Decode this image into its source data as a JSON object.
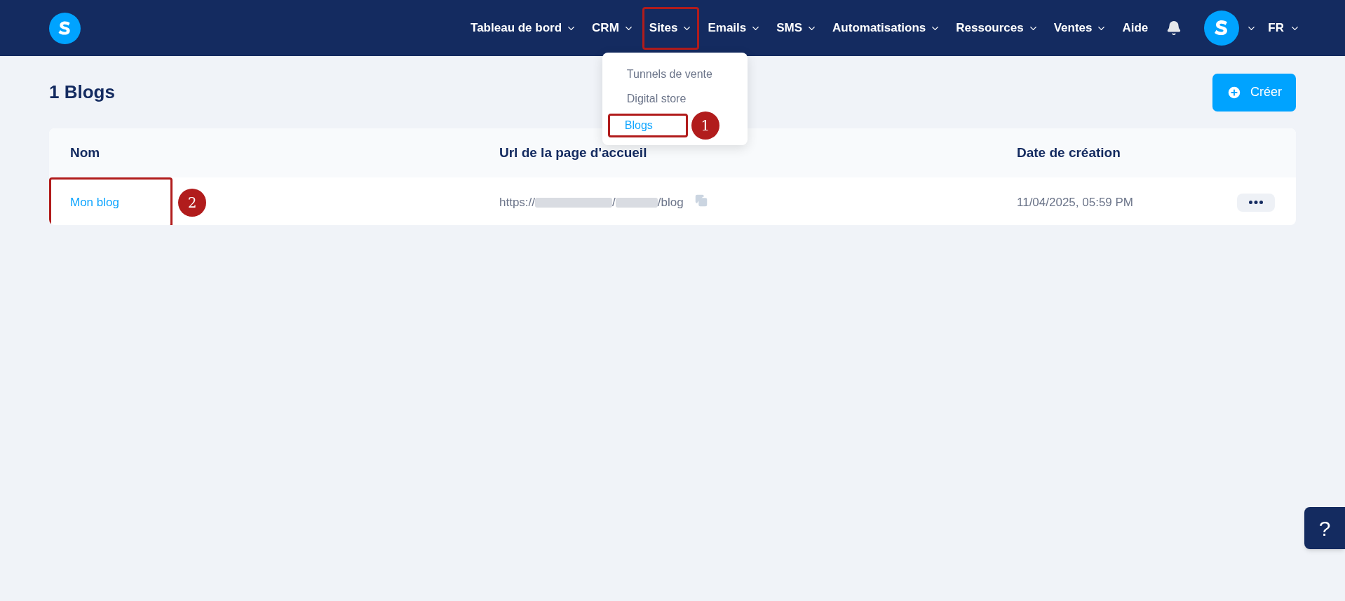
{
  "nav": {
    "items": [
      {
        "label": "Tableau de bord",
        "has_menu": true,
        "highlighted": false
      },
      {
        "label": "CRM",
        "has_menu": true,
        "highlighted": false
      },
      {
        "label": "Sites",
        "has_menu": true,
        "highlighted": true,
        "dropdown": [
          {
            "label": "Tunnels de vente",
            "selected": false,
            "highlighted": false
          },
          {
            "label": "Digital store",
            "selected": false,
            "highlighted": false
          },
          {
            "label": "Blogs",
            "selected": true,
            "highlighted": true,
            "badge": "1"
          }
        ]
      },
      {
        "label": "Emails",
        "has_menu": true,
        "highlighted": false
      },
      {
        "label": "SMS",
        "has_menu": true,
        "highlighted": false
      },
      {
        "label": "Automatisations",
        "has_menu": true,
        "highlighted": false
      },
      {
        "label": "Ressources",
        "has_menu": true,
        "highlighted": false
      },
      {
        "label": "Ventes",
        "has_menu": true,
        "highlighted": false
      },
      {
        "label": "Aide",
        "has_menu": false,
        "highlighted": false
      }
    ],
    "language": "FR"
  },
  "page": {
    "title": "1 Blogs",
    "create_button": "Créer"
  },
  "table": {
    "columns": [
      "Nom",
      "Url de la page d'accueil",
      "Date de création"
    ],
    "rows": [
      {
        "name": "Mon blog",
        "highlighted": true,
        "badge": "2",
        "url_start": "https://",
        "url_middle": "/",
        "url_end": "/blog",
        "created": "11/04/2025, 05:59 PM"
      }
    ]
  },
  "help_button": "?"
}
